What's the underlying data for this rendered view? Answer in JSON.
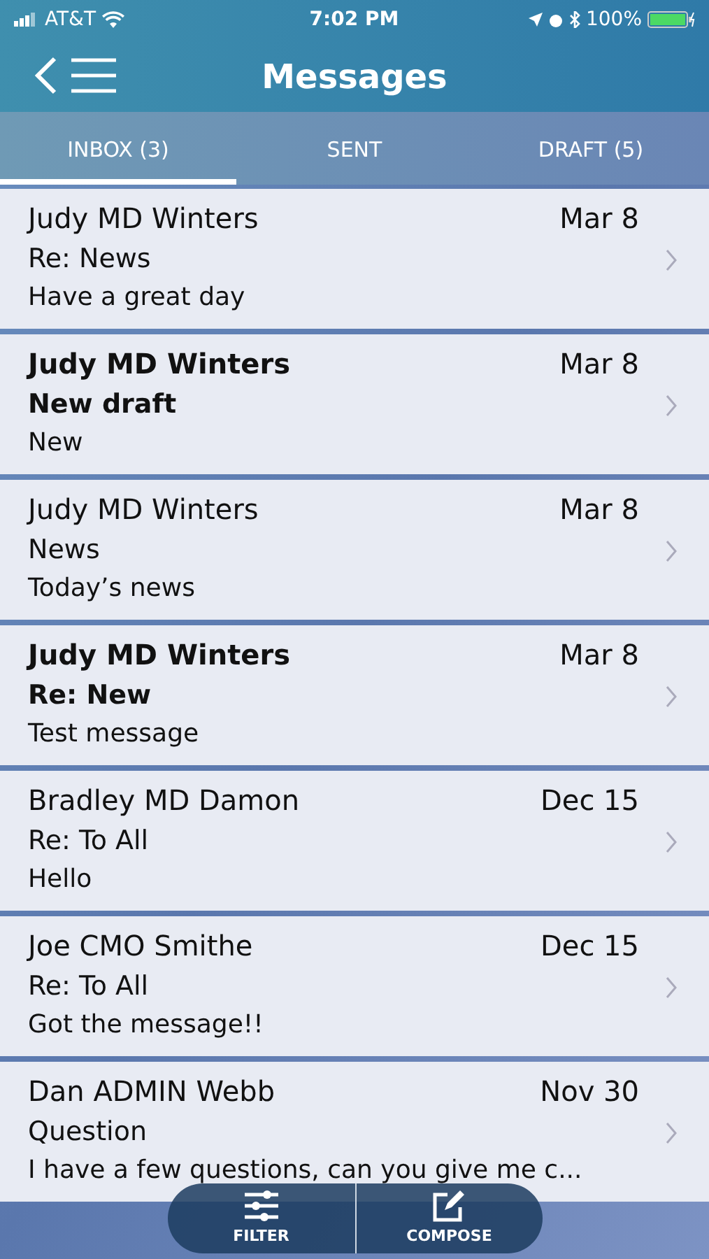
{
  "status_bar": {
    "carrier": "AT&T",
    "time": "7:02 PM",
    "battery": "100%"
  },
  "header": {
    "title": "Messages"
  },
  "tabs": [
    {
      "label": "INBOX (3)",
      "selected": true
    },
    {
      "label": "SENT",
      "selected": false
    },
    {
      "label": "DRAFT (5)",
      "selected": false
    }
  ],
  "messages": [
    {
      "sender": "Judy MD Winters",
      "date": "Mar 8",
      "subject": "Re: News",
      "preview": "Have a great day",
      "unread": false
    },
    {
      "sender": "Judy MD Winters",
      "date": "Mar 8",
      "subject": "New draft",
      "preview": "New",
      "unread": true
    },
    {
      "sender": "Judy MD Winters",
      "date": "Mar 8",
      "subject": "News",
      "preview": "Today’s news",
      "unread": false
    },
    {
      "sender": "Judy MD Winters",
      "date": "Mar 8",
      "subject": "Re: New",
      "preview": "Test message",
      "unread": true
    },
    {
      "sender": "Bradley MD Damon",
      "date": "Dec 15",
      "subject": "Re: To All",
      "preview": "Hello",
      "unread": false
    },
    {
      "sender": "Joe CMO Smithe",
      "date": "Dec 15",
      "subject": "Re: To All",
      "preview": "Got the message!!",
      "unread": false
    },
    {
      "sender": "Dan ADMIN Webb",
      "date": "Nov 30",
      "subject": "Question",
      "preview": "I have a few questions, can you give me c...",
      "unread": false
    }
  ],
  "toolbar": [
    {
      "label": "FILTER",
      "kind": "filter"
    },
    {
      "label": "COMPOSE",
      "kind": "compose"
    }
  ]
}
